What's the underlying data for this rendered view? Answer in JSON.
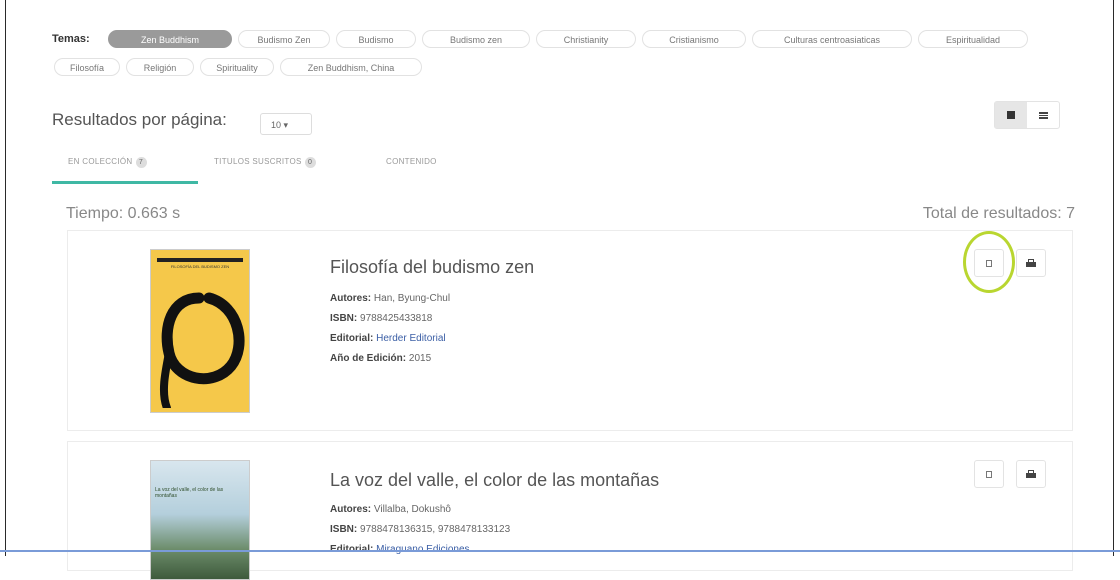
{
  "topics": {
    "label": "Temas:",
    "chips": [
      {
        "label": "Zen Buddhism",
        "active": true
      },
      {
        "label": "Budismo Zen",
        "active": false
      },
      {
        "label": "Budismo",
        "active": false
      },
      {
        "label": "Budismo zen",
        "active": false
      },
      {
        "label": "Christianity",
        "active": false
      },
      {
        "label": "Cristianismo",
        "active": false
      },
      {
        "label": "Culturas centroasiaticas",
        "active": false
      },
      {
        "label": "Espiritualidad",
        "active": false
      },
      {
        "label": "Filosofía",
        "active": false
      },
      {
        "label": "Religión",
        "active": false
      },
      {
        "label": "Spirituality",
        "active": false
      },
      {
        "label": "Zen Buddhism, China",
        "active": false
      }
    ]
  },
  "results_per_page": {
    "label": "Resultados por página:",
    "value": "10 ▾"
  },
  "view_toggle": {
    "grid_icon": "grid-view-icon",
    "list_icon": "list-view-icon"
  },
  "tabs": [
    {
      "label": "EN COLECCIÓN",
      "count": "7"
    },
    {
      "label": "TITULOS SUSCRITOS",
      "count": "0"
    },
    {
      "label": "CONTENIDO",
      "count": ""
    }
  ],
  "timing": "Tiempo: 0.663 s",
  "total": "Total de resultados: 7",
  "accent_color": "#3fb8a4",
  "highlight_color": "#b9d630",
  "results": [
    {
      "title": "Filosofía del budismo zen",
      "authors_label": "Autores:",
      "authors": "Han, Byung-Chul",
      "isbn_label": "ISBN:",
      "isbn": "9788425433818",
      "publisher_label": "Editorial:",
      "publisher": "Herder Editorial",
      "year_label": "Año de Edición:",
      "year": "2015",
      "cover_text": "FILOSOFÍA DEL BUDISMO ZEN",
      "cover_color": "#f5c84a"
    },
    {
      "title": "La voz del valle, el color de las montañas",
      "authors_label": "Autores:",
      "authors": "Villalba, Dokushô",
      "isbn_label": "ISBN:",
      "isbn": "9788478136315, 9788478133123",
      "publisher_label": "Editorial:",
      "publisher": "Miraguano Ediciones",
      "cover_text": "La voz del valle, el color de las montañas"
    }
  ]
}
